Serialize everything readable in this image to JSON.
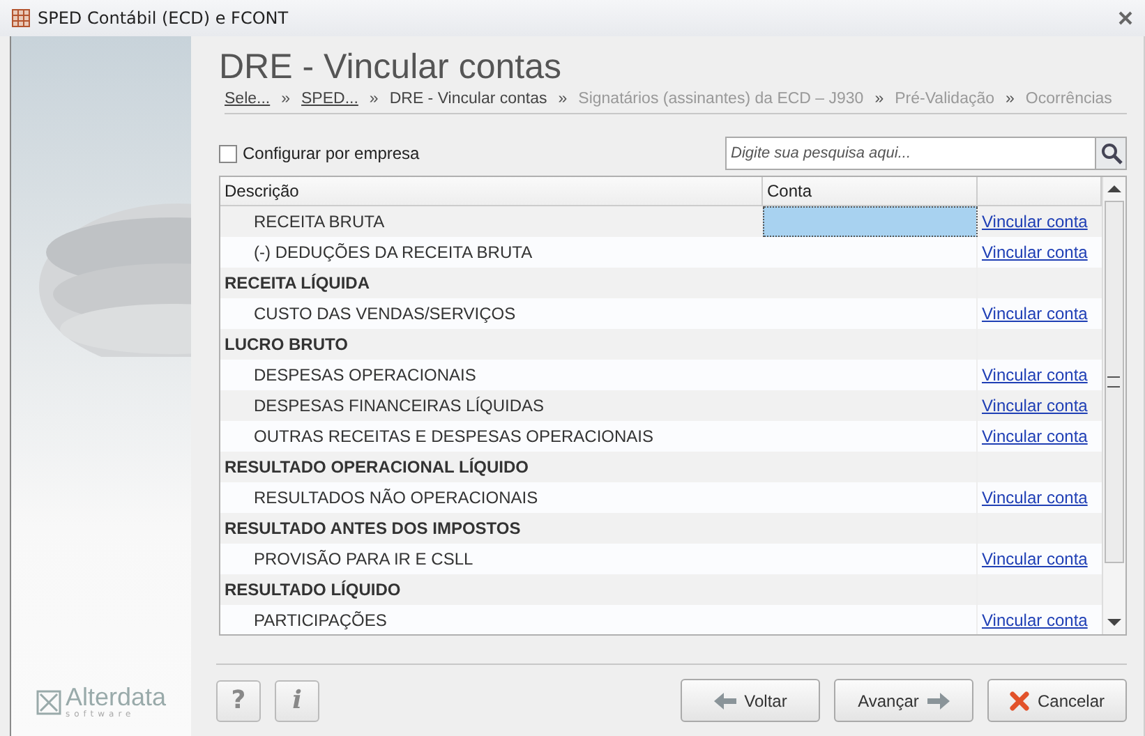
{
  "window": {
    "title": "SPED Contábil (ECD) e FCONT"
  },
  "page_title": "DRE - Vincular contas",
  "breadcrumbs": [
    {
      "label": "Sele...",
      "kind": "link"
    },
    {
      "label": "SPED...",
      "kind": "link"
    },
    {
      "label": "DRE - Vincular contas",
      "kind": "current"
    },
    {
      "label": "Signatários (assinantes) da ECD – J930",
      "kind": "pending"
    },
    {
      "label": "Pré-Validação",
      "kind": "pending"
    },
    {
      "label": "Ocorrências",
      "kind": "pending"
    }
  ],
  "breadcrumb_separator": "»",
  "config_checkbox": {
    "label": "Configurar por empresa",
    "checked": false
  },
  "search": {
    "placeholder": "Digite sua pesquisa aqui..."
  },
  "table": {
    "columns": [
      "Descrição",
      "Conta"
    ],
    "rows": [
      {
        "kind": "item",
        "description": "RECEITA BRUTA",
        "link": "Vincular conta",
        "selected": true
      },
      {
        "kind": "item",
        "description": "(-) DEDUÇÕES DA RECEITA BRUTA",
        "link": "Vincular conta",
        "selected": false
      },
      {
        "kind": "group",
        "description": "RECEITA LÍQUIDA",
        "selected": false
      },
      {
        "kind": "item",
        "description": "CUSTO DAS VENDAS/SERVIÇOS",
        "link": "Vincular conta",
        "selected": false
      },
      {
        "kind": "group",
        "description": "LUCRO BRUTO",
        "selected": false
      },
      {
        "kind": "item",
        "description": "DESPESAS OPERACIONAIS",
        "link": "Vincular conta",
        "selected": false
      },
      {
        "kind": "item",
        "description": "DESPESAS FINANCEIRAS LÍQUIDAS",
        "link": "Vincular conta",
        "selected": false
      },
      {
        "kind": "item",
        "description": "OUTRAS RECEITAS E DESPESAS OPERACIONAIS",
        "link": "Vincular conta",
        "selected": false
      },
      {
        "kind": "group",
        "description": "RESULTADO OPERACIONAL LÍQUIDO",
        "selected": false
      },
      {
        "kind": "item",
        "description": "RESULTADOS NÃO OPERACIONAIS",
        "link": "Vincular conta",
        "selected": false
      },
      {
        "kind": "group",
        "description": "RESULTADO ANTES DOS IMPOSTOS",
        "selected": false
      },
      {
        "kind": "item",
        "description": "PROVISÃO PARA IR E CSLL",
        "link": "Vincular conta",
        "selected": false
      },
      {
        "kind": "group",
        "description": "RESULTADO LÍQUIDO",
        "selected": false
      },
      {
        "kind": "item",
        "description": "PARTICIPAÇÕES",
        "link": "Vincular conta",
        "selected": false
      }
    ]
  },
  "logo": {
    "name": "Alterdata",
    "tagline": "software"
  },
  "footer": {
    "help": "?",
    "info": "i",
    "buttons": [
      {
        "kind": "back",
        "label": "Voltar"
      },
      {
        "kind": "next",
        "label": "Avançar"
      },
      {
        "kind": "cancel",
        "label": "Cancelar"
      }
    ]
  }
}
